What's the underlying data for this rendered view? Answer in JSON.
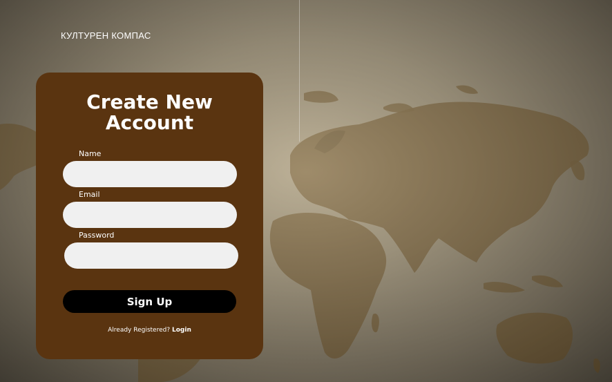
{
  "header": {
    "brand": "КУЛТУРЕН КОМПАС"
  },
  "form": {
    "title_line1": "Create New",
    "title_line2": "Account",
    "name_label": "Name",
    "name_value": "",
    "email_label": "Email",
    "email_value": "",
    "password_label": "Password",
    "password_value": "",
    "submit_label": "Sign Up",
    "already_text": "Already Registered?",
    "login_link": "Login"
  },
  "colors": {
    "card": "#5a3410",
    "button": "#000000",
    "input": "#f0f0f0",
    "map": "#6b4f22"
  }
}
